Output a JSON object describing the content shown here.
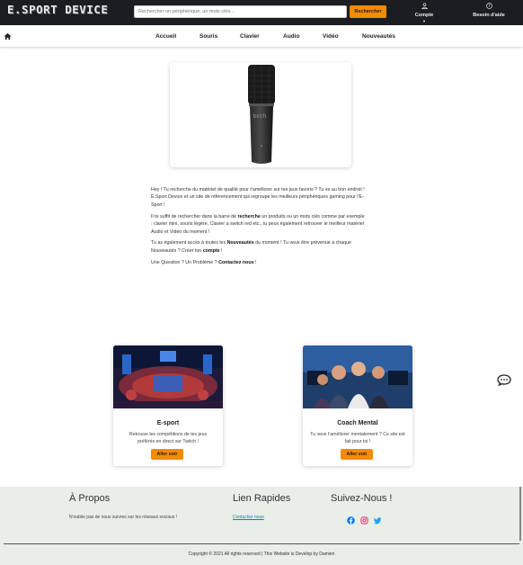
{
  "header": {
    "logo_text": "E.SPORT DEVICE",
    "search_placeholder": "Rechercher un périphérique, un mots clés...",
    "search_button": "Rechercher",
    "account_label": "Compte",
    "help_label": "Besoin d'aide"
  },
  "nav": {
    "items": [
      {
        "label": "Accueil"
      },
      {
        "label": "Souris"
      },
      {
        "label": "Clavier"
      },
      {
        "label": "Audio"
      },
      {
        "label": "Vidéo"
      },
      {
        "label": "Nouveautés"
      }
    ]
  },
  "intro": {
    "p1": "Hey ! Tu recherche du matériel de qualité pour t'améliorer sur tes jeux favoris ? Tu es au bon endroit ! E.Sport Device et un site de référencement qui regroupe les meilleurs périphériques gaming pour l'E-Sport !",
    "p2_a": "Il te suffit de rechercher dans la barre de ",
    "p2_b": "recherche",
    "p2_c": " un produits ou un mots clés comme par exemple : clavier mini, souris légère, Clavier a switch red etc., tu peux également retrouver le meilleur matériel Audio et Vidéo du moment !",
    "p3_a": "Tu as également accès à toutes les ",
    "p3_b": "Nouveautés",
    "p3_c": " du moment ! Tu veux être prévenue a chaque Nouveautés ? Créer ton ",
    "p3_d": "compte",
    "p3_e": " !",
    "p4_a": "Une Question ? Un Problème ? ",
    "p4_b": "Contactez nous",
    "p4_c": " !"
  },
  "cards": [
    {
      "title": "E-sport",
      "desc": "Retrouve les compétitions de tes jeux préférés en direct sur Twitch !",
      "button": "Aller voir"
    },
    {
      "title": "Coach Mental",
      "desc": "Tu veux t'améliorer mentalement ? Ce site est fait pour toi !",
      "button": "Aller voir"
    }
  ],
  "footer": {
    "about_title": "À Propos",
    "about_text": "N'oublie pas de nous suivres sur les réseaux sociaux !",
    "links_title": "Lien Rapides",
    "contact_link": "Contactez nous",
    "follow_title": "Suivez-Nous !",
    "copyright": "Copyright © 2021 All rights reserved | This Website is Develop by Damien"
  },
  "colors": {
    "accent": "#f28c00",
    "topbar": "#1c1d21",
    "footer_bg": "#e8eee8",
    "link": "#2a6fd6"
  },
  "icons": [
    "user-icon",
    "help-circle-icon",
    "home-icon",
    "chat-icon",
    "facebook-icon",
    "instagram-icon",
    "twitter-icon"
  ]
}
